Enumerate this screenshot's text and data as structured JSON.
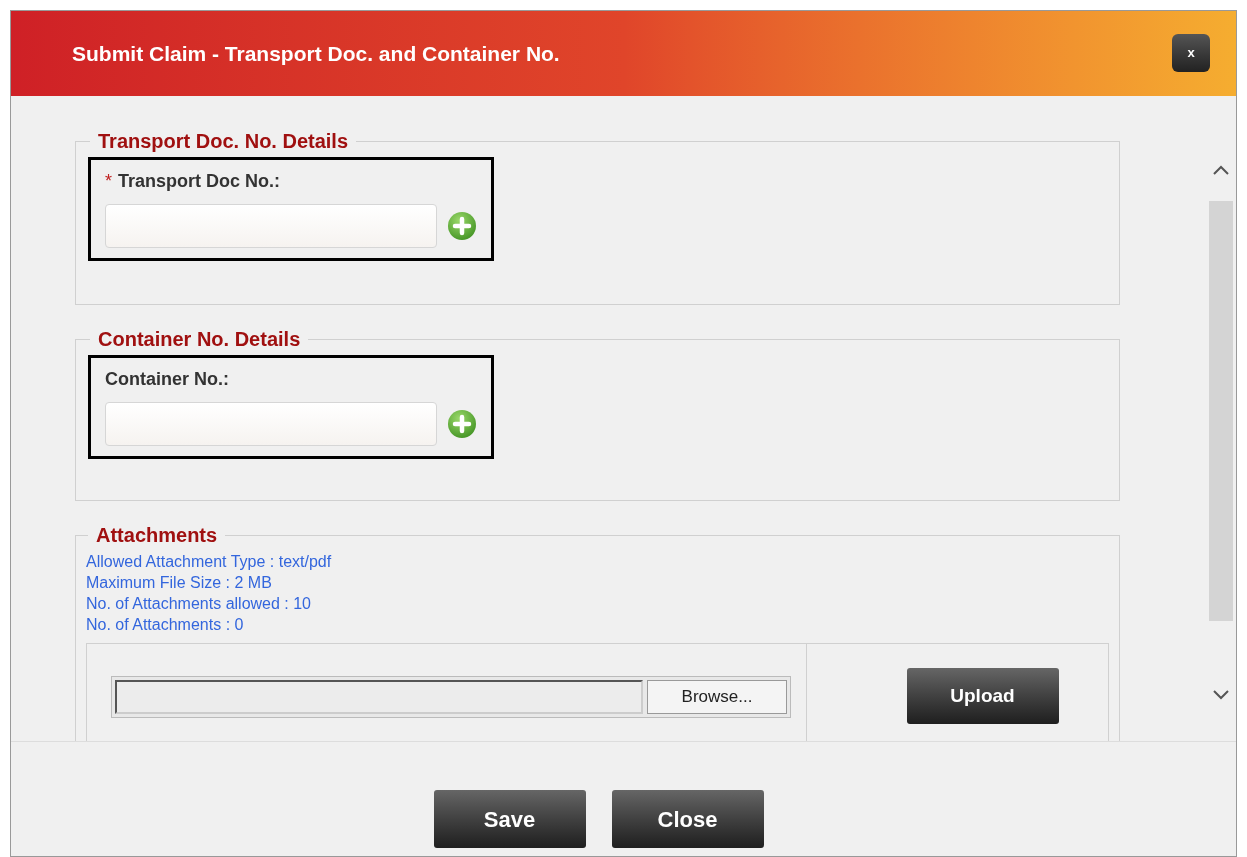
{
  "window": {
    "title": "Submit Claim - Transport Doc. and Container No.",
    "close_label": "x"
  },
  "sections": [
    {
      "legend": "Transport Doc. No. Details",
      "field": {
        "required_mark": "*",
        "label": "Transport Doc No.:"
      }
    },
    {
      "legend": "Container No. Details",
      "field": {
        "label": "Container No.:"
      }
    }
  ],
  "attachments": {
    "legend": "Attachments",
    "info": [
      "Allowed Attachment Type : text/pdf",
      "Maximum File Size : 2 MB",
      "No. of Attachments allowed : 10",
      "No. of Attachments : 0"
    ],
    "browse_label": "Browse...",
    "upload_label": "Upload"
  },
  "buttons": [
    {
      "label": "Save"
    },
    {
      "label": "Close"
    }
  ]
}
